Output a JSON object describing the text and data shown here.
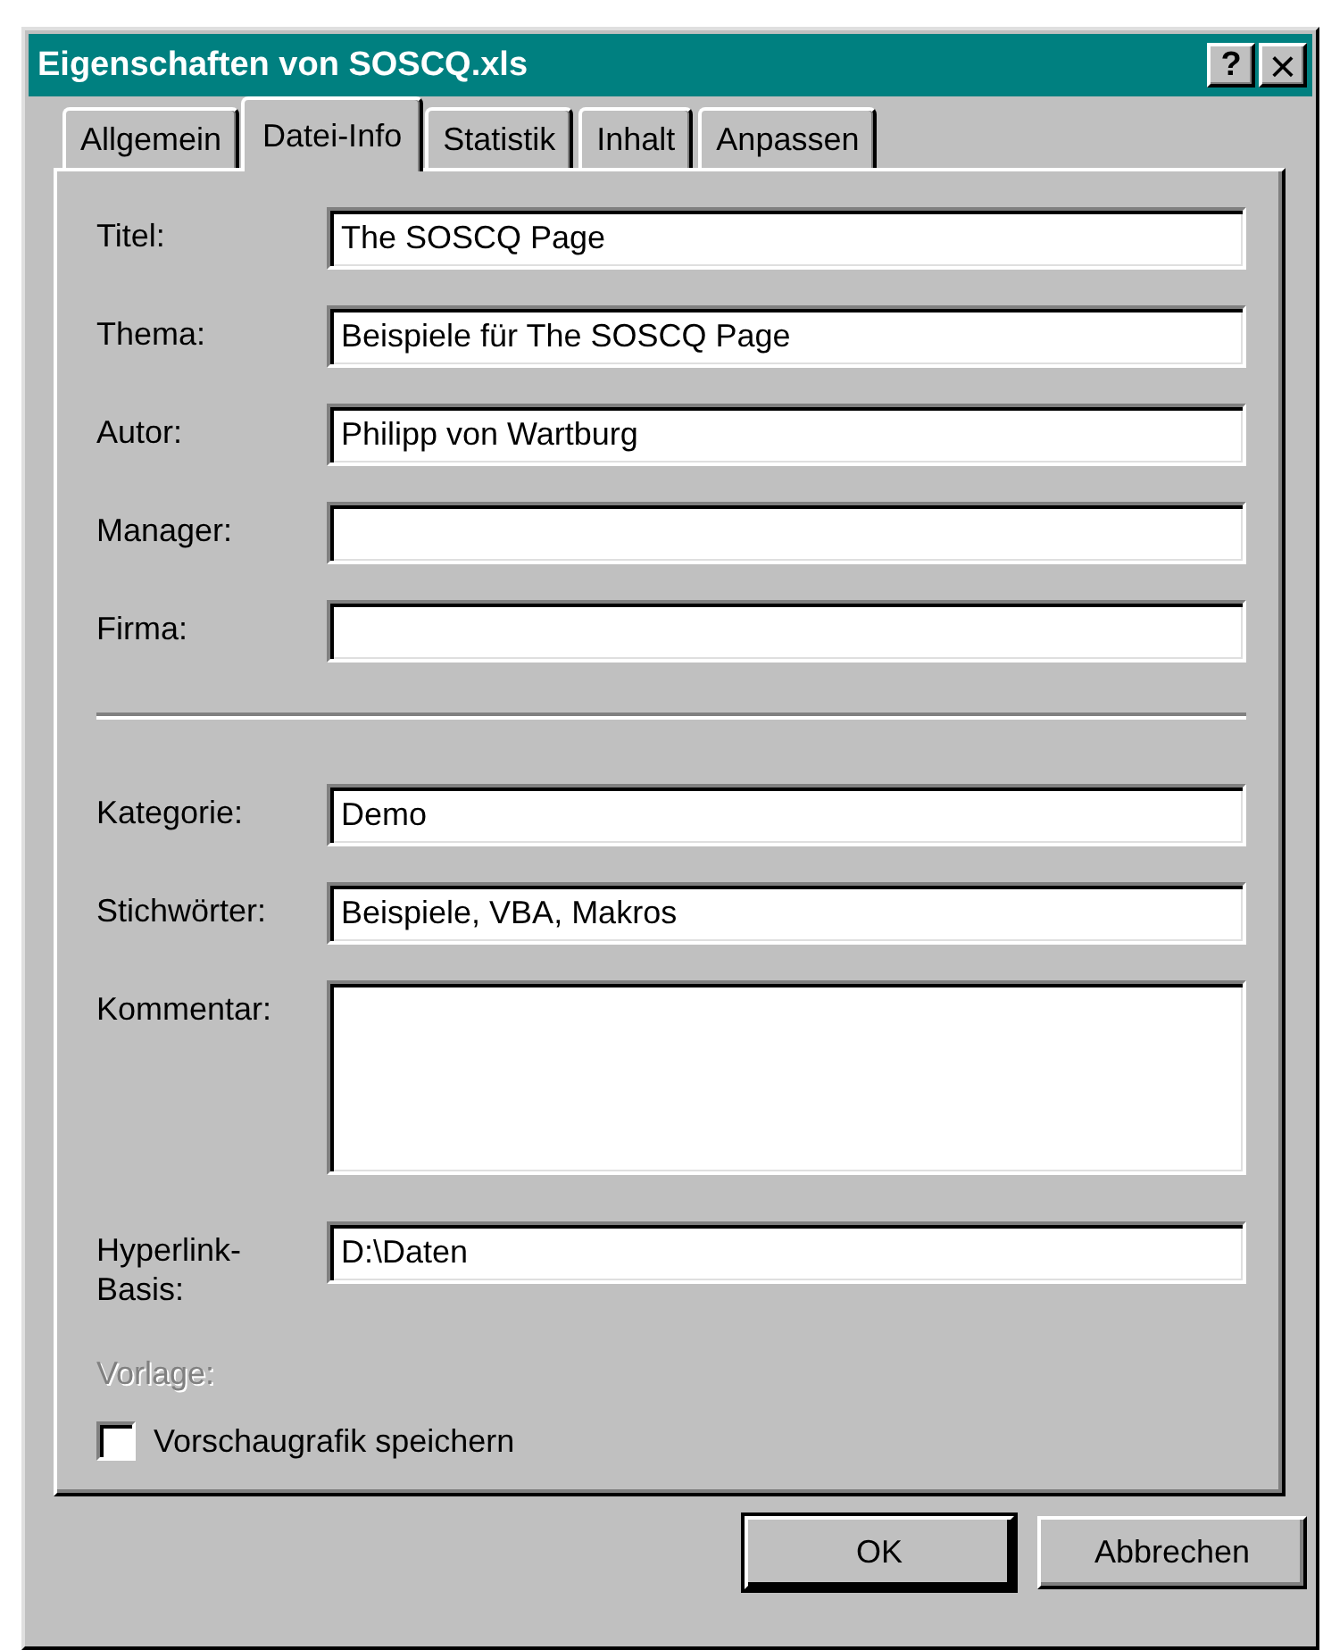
{
  "window": {
    "title": "Eigenschaften von SOSCQ.xls",
    "title_buttons": [
      {
        "kind": "help",
        "label": "?"
      },
      {
        "kind": "close",
        "label": "×"
      }
    ]
  },
  "tabs": [
    {
      "label": "Allgemein",
      "selected": false
    },
    {
      "label": "Datei-Info",
      "selected": true
    },
    {
      "label": "Statistik",
      "selected": false
    },
    {
      "label": "Inhalt",
      "selected": false
    },
    {
      "label": "Anpassen",
      "selected": false
    }
  ],
  "sections": [
    {
      "fields": [
        {
          "kind": "text",
          "label": "Titel:",
          "value": "The SOSCQ Page",
          "disabled": false
        },
        {
          "kind": "text",
          "label": "Thema:",
          "value": "Beispiele für The SOSCQ Page",
          "disabled": false
        },
        {
          "kind": "text",
          "label": "Autor:",
          "value": "Philipp von Wartburg",
          "disabled": false
        },
        {
          "kind": "text",
          "label": "Manager:",
          "disabled": false
        },
        {
          "kind": "text",
          "label": "Firma:",
          "disabled": false
        }
      ]
    },
    {
      "fields": [
        {
          "kind": "text",
          "label": "Kategorie:",
          "value": "Demo",
          "disabled": false
        },
        {
          "kind": "text",
          "label": "Stichwörter:",
          "value": "Beispiele, VBA, Makros",
          "disabled": false
        },
        {
          "kind": "multiline",
          "label": "Kommentar:",
          "disabled": false
        },
        {
          "kind": "text",
          "label": "Hyperlink-Basis:",
          "value": "D:\\Daten",
          "disabled": false
        },
        {
          "kind": "static",
          "label": "Vorlage:",
          "disabled": true
        }
      ]
    }
  ],
  "checkbox": {
    "label": "Vorschaugrafik speichern",
    "checked": false
  },
  "buttons": [
    {
      "label": "OK",
      "default": true
    },
    {
      "label": "Abbrechen",
      "default": false
    }
  ]
}
